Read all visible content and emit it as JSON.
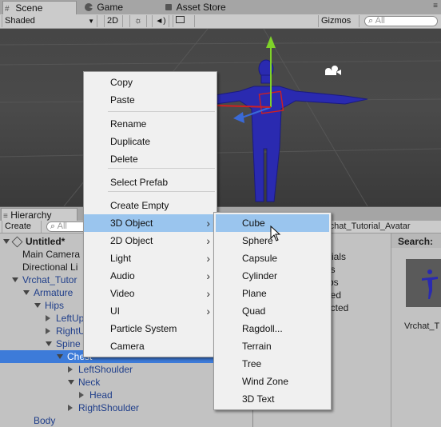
{
  "top_tabs": [
    {
      "label": "Scene",
      "icon": "scene-grid-icon"
    },
    {
      "label": "Game",
      "icon": "game-pacman-icon"
    },
    {
      "label": "Asset Store",
      "icon": "asset-store-icon"
    }
  ],
  "scene_toolbar": {
    "shading_mode": "Shaded",
    "mode_2d": "2D",
    "gizmos": "Gizmos",
    "search_placeholder": "All"
  },
  "hierarchy": {
    "tab_label": "Hierarchy",
    "create_label": "Create",
    "search_placeholder": "All",
    "scene_name": "Untitled*",
    "rows": [
      {
        "label": "Main Camera",
        "indent": 1,
        "color": "black",
        "arrow": "none"
      },
      {
        "label": "Directional Li",
        "indent": 1,
        "color": "black",
        "arrow": "none"
      },
      {
        "label": "Vrchat_Tutor",
        "indent": 1,
        "color": "blue",
        "arrow": "down"
      },
      {
        "label": "Armature",
        "indent": 2,
        "color": "blue",
        "arrow": "down"
      },
      {
        "label": "Hips",
        "indent": 3,
        "color": "blue",
        "arrow": "down"
      },
      {
        "label": "LeftUp",
        "indent": 4,
        "color": "blue",
        "arrow": "right"
      },
      {
        "label": "RightU",
        "indent": 4,
        "color": "blue",
        "arrow": "right"
      },
      {
        "label": "Spine",
        "indent": 4,
        "color": "blue",
        "arrow": "down"
      },
      {
        "label": "Chest",
        "indent": 5,
        "color": "blue",
        "arrow": "down",
        "selected": true
      },
      {
        "label": "LeftShoulder",
        "indent": 6,
        "color": "blue",
        "arrow": "right"
      },
      {
        "label": "Neck",
        "indent": 6,
        "color": "blue",
        "arrow": "down"
      },
      {
        "label": "Head",
        "indent": 7,
        "color": "blue",
        "arrow": "right"
      },
      {
        "label": "RightShoulder",
        "indent": 6,
        "color": "blue",
        "arrow": "right"
      },
      {
        "label": "Body",
        "indent": 2,
        "color": "blue",
        "arrow": "none"
      }
    ]
  },
  "project": {
    "breadcrumb": "rchat_Tutorial_Avatar",
    "search_label": "Search:",
    "list_fragments": [
      "rials",
      "ls",
      "bs",
      "ied",
      "icted"
    ],
    "asset_name": "Vrchat_T"
  },
  "context_menu": {
    "items": [
      {
        "label": "Copy"
      },
      {
        "label": "Paste"
      },
      {
        "label": "Rename"
      },
      {
        "label": "Duplicate"
      },
      {
        "label": "Delete"
      },
      {
        "label": "Select Prefab"
      },
      {
        "label": "Create Empty"
      },
      {
        "label": "3D Object",
        "submenu": true,
        "highlighted": true
      },
      {
        "label": "2D Object",
        "submenu": true
      },
      {
        "label": "Light",
        "submenu": true
      },
      {
        "label": "Audio",
        "submenu": true
      },
      {
        "label": "Video",
        "submenu": true
      },
      {
        "label": "UI",
        "submenu": true
      },
      {
        "label": "Particle System"
      },
      {
        "label": "Camera"
      }
    ]
  },
  "submenu_3d": {
    "items": [
      {
        "label": "Cube",
        "highlighted": true
      },
      {
        "label": "Sphere"
      },
      {
        "label": "Capsule"
      },
      {
        "label": "Cylinder"
      },
      {
        "label": "Plane"
      },
      {
        "label": "Quad"
      },
      {
        "label": "Ragdoll..."
      },
      {
        "label": "Terrain"
      },
      {
        "label": "Tree"
      },
      {
        "label": "Wind Zone"
      },
      {
        "label": "3D Text"
      }
    ]
  },
  "colors": {
    "selection_blue": "#3d7bd9",
    "menu_highlight": "#9ac5ee",
    "avatar_blue": "#2a2ab0",
    "gizmo_green": "#7fd22a"
  }
}
